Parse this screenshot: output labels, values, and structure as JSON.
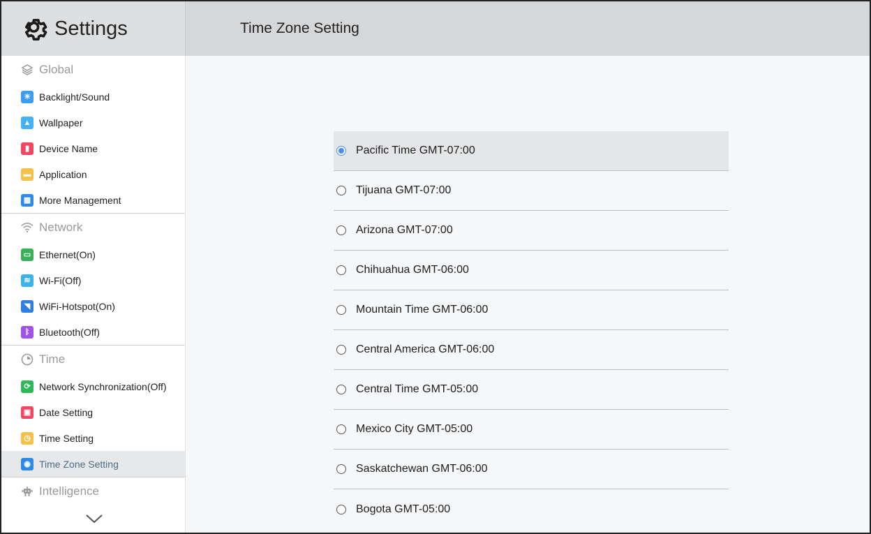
{
  "header": {
    "app_title": "Settings",
    "page_title": "Time Zone Setting"
  },
  "sidebar": {
    "sections": [
      {
        "title": "Global",
        "icon": "layers-icon",
        "items": [
          {
            "label": "Backlight/Sound",
            "icon": "backlight-sound-icon",
            "color": "#3b9cf0"
          },
          {
            "label": "Wallpaper",
            "icon": "wallpaper-icon",
            "color": "#43b1f2"
          },
          {
            "label": "Device Name",
            "icon": "device-name-icon",
            "color": "#f04860"
          },
          {
            "label": "Application",
            "icon": "application-icon",
            "color": "#f5c14a"
          },
          {
            "label": "More Management",
            "icon": "more-management-icon",
            "color": "#2d8ae6"
          }
        ]
      },
      {
        "title": "Network",
        "icon": "wifi-icon",
        "items": [
          {
            "label": "Ethernet(On)",
            "icon": "ethernet-icon",
            "color": "#38b25a"
          },
          {
            "label": "Wi-Fi(Off)",
            "icon": "wifi-item-icon",
            "color": "#3cb3e8"
          },
          {
            "label": "WiFi-Hotspot(On)",
            "icon": "hotspot-icon",
            "color": "#2f7fe0"
          },
          {
            "label": "Bluetooth(Off)",
            "icon": "bluetooth-icon",
            "color": "#a052e8"
          }
        ]
      },
      {
        "title": "Time",
        "icon": "clock-icon",
        "items": [
          {
            "label": "Network Synchronization(Off)",
            "icon": "sync-icon",
            "color": "#2fb85a"
          },
          {
            "label": "Date Setting",
            "icon": "calendar-icon",
            "color": "#f04860"
          },
          {
            "label": "Time Setting",
            "icon": "time-setting-icon",
            "color": "#f5c14a"
          },
          {
            "label": "Time Zone Setting",
            "icon": "timezone-icon",
            "color": "#2d8ae6",
            "active": true
          }
        ]
      },
      {
        "title": "Intelligence",
        "icon": "robot-icon",
        "items": []
      }
    ]
  },
  "timezones": [
    {
      "label": "Pacific Time GMT-07:00",
      "selected": true
    },
    {
      "label": "Tijuana GMT-07:00",
      "selected": false
    },
    {
      "label": "Arizona GMT-07:00",
      "selected": false
    },
    {
      "label": "Chihuahua GMT-06:00",
      "selected": false
    },
    {
      "label": "Mountain Time GMT-06:00",
      "selected": false
    },
    {
      "label": "Central America GMT-06:00",
      "selected": false
    },
    {
      "label": "Central Time GMT-05:00",
      "selected": false
    },
    {
      "label": "Mexico City GMT-05:00",
      "selected": false
    },
    {
      "label": "Saskatchewan GMT-06:00",
      "selected": false
    },
    {
      "label": "Bogota GMT-05:00",
      "selected": false
    }
  ],
  "colors": {
    "accent": "#4c8ff4",
    "header_bg": "#d5d7d9",
    "content_bg": "#f6f7f9"
  }
}
